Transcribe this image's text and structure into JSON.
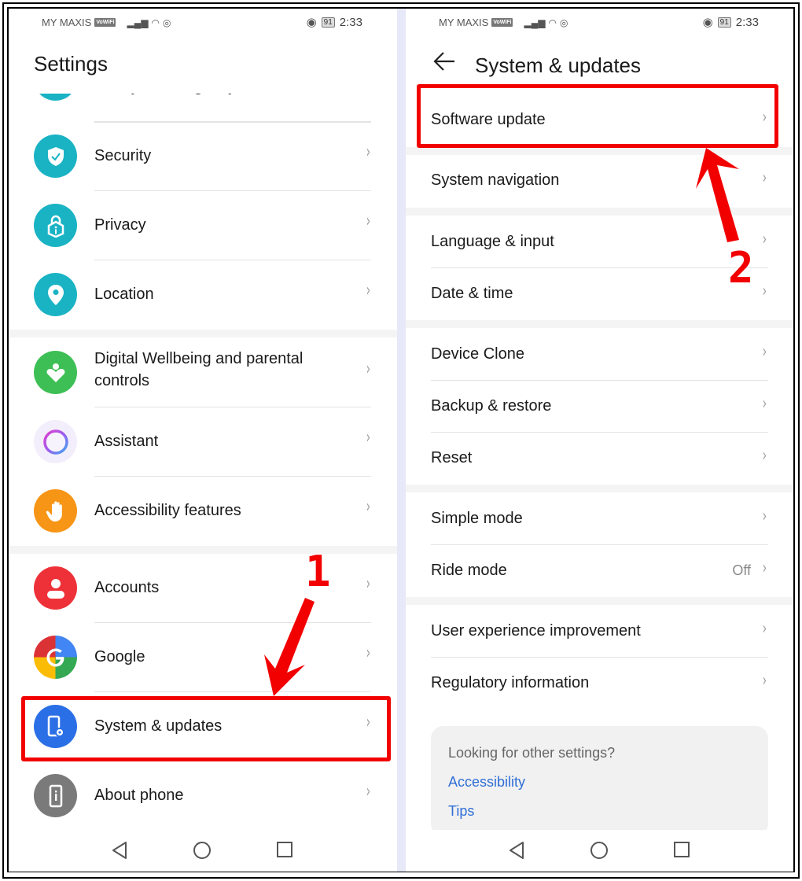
{
  "status_bar": {
    "carrier": "MY MAXIS",
    "vowifi_badge": "VoWiFi",
    "battery": "91",
    "time": "2:33"
  },
  "left_screen": {
    "title": "Settings",
    "partial_top_item": "Safety & emergency",
    "items": [
      {
        "label": "Security",
        "icon": "shield-check-icon",
        "color": "#19b3c4"
      },
      {
        "label": "Privacy",
        "icon": "lock-info-icon",
        "color": "#19b3c4"
      },
      {
        "label": "Location",
        "icon": "location-pin-icon",
        "color": "#19b3c4"
      },
      {
        "label": "Digital Wellbeing and parental controls",
        "icon": "heart-person-icon",
        "color": "#3dbf55"
      },
      {
        "label": "Assistant",
        "icon": "assistant-ring-icon",
        "color": "#f3eefb"
      },
      {
        "label": "Accessibility features",
        "icon": "hand-icon",
        "color": "#f79516"
      },
      {
        "label": "Accounts",
        "icon": "person-icon",
        "color": "#ee3138"
      },
      {
        "label": "Google",
        "icon": "google-g-icon",
        "color": "#4285f4"
      },
      {
        "label": "System & updates",
        "icon": "phone-gear-icon",
        "color": "#2b6fe6"
      },
      {
        "label": "About phone",
        "icon": "phone-info-icon",
        "color": "#7a7a7a"
      }
    ],
    "annotation_step": "1"
  },
  "right_screen": {
    "back_label": "←",
    "title": "System & updates",
    "items": [
      {
        "label": "Software update"
      },
      {
        "label": "System navigation"
      },
      {
        "label": "Language & input"
      },
      {
        "label": "Date & time"
      },
      {
        "label": "Device Clone"
      },
      {
        "label": "Backup & restore"
      },
      {
        "label": "Reset"
      },
      {
        "label": "Simple mode"
      },
      {
        "label": "Ride mode",
        "value": "Off"
      },
      {
        "label": "User experience improvement"
      },
      {
        "label": "Regulatory information"
      }
    ],
    "suggestion_card": {
      "question": "Looking for other settings?",
      "links": [
        "Accessibility",
        "Tips"
      ]
    },
    "annotation_step": "2"
  },
  "chevron": "›",
  "colors": {
    "annotation_red": "#f20000",
    "link_blue": "#2f6fd6"
  }
}
